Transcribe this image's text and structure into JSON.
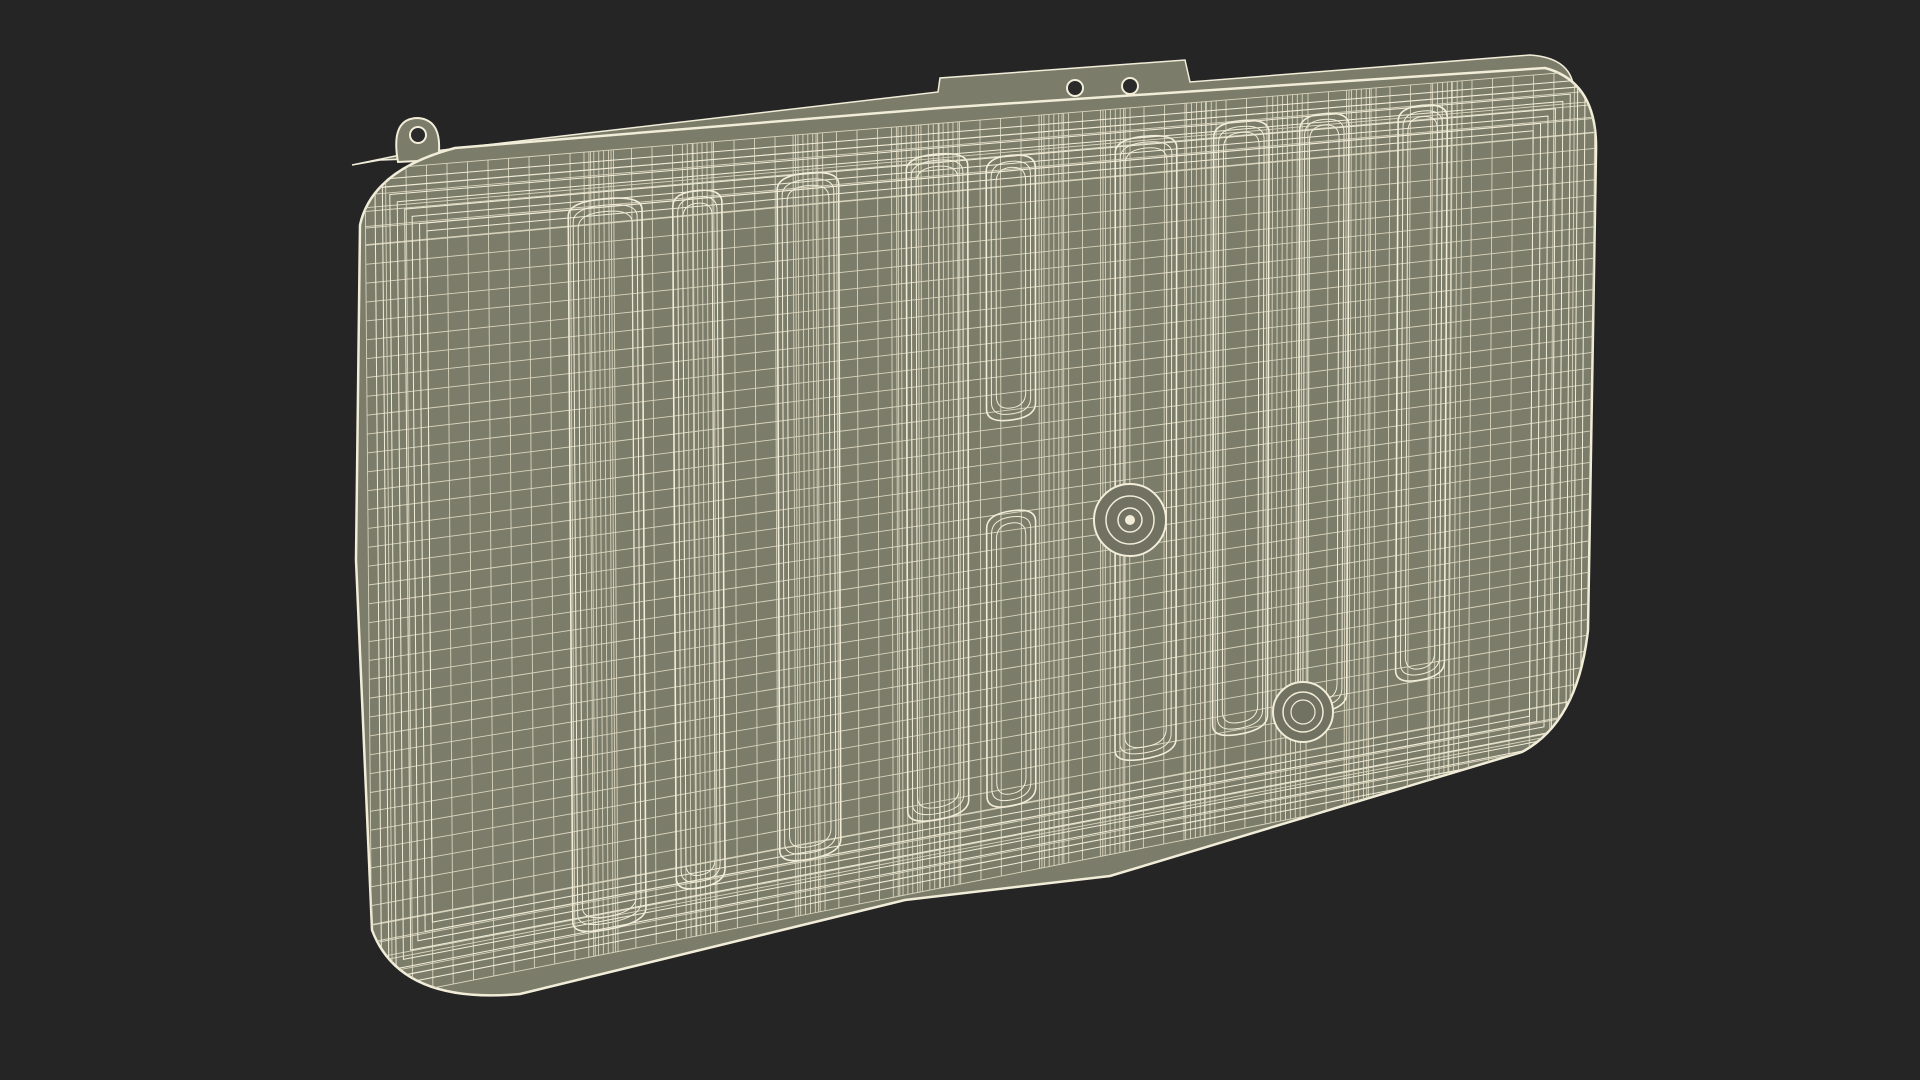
{
  "scene": {
    "subject": "tank-wireframe-render",
    "colors": {
      "background": "#252525",
      "surface": "#7c7c6b",
      "surface_dark": "#6f6f60",
      "wire": "#f1edd8",
      "wire_dim": "#d9d5bd"
    }
  }
}
